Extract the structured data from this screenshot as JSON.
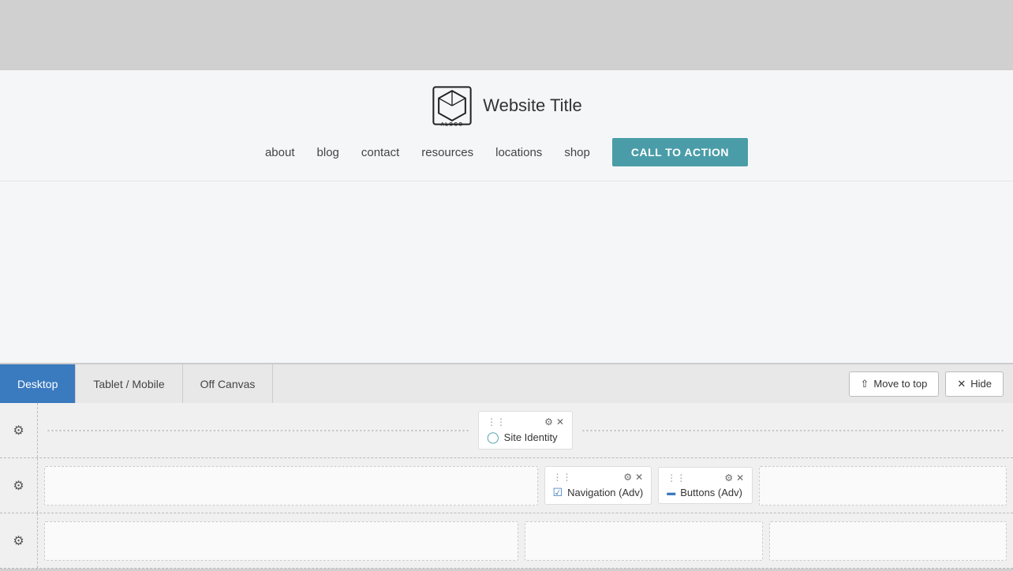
{
  "topArea": {
    "height": 88
  },
  "siteHeader": {
    "logoAlt": "ALOGO",
    "siteTitle": "Website Title",
    "navItems": [
      {
        "label": "about"
      },
      {
        "label": "blog"
      },
      {
        "label": "contact"
      },
      {
        "label": "resources"
      },
      {
        "label": "locations"
      },
      {
        "label": "shop"
      }
    ],
    "ctaLabel": "CALL TO ACTION"
  },
  "toolbar": {
    "tabs": [
      {
        "label": "Desktop",
        "active": true
      },
      {
        "label": "Tablet / Mobile",
        "active": false
      },
      {
        "label": "Off Canvas",
        "active": false
      }
    ],
    "moveToTopLabel": "Move to top",
    "hideLabel": "Hide"
  },
  "builderRows": [
    {
      "id": "row1",
      "widgets": [
        {
          "label": "Site Identity",
          "icon": "circle-icon"
        }
      ]
    },
    {
      "id": "row2",
      "widgets": [
        {
          "label": "Navigation (Adv)",
          "icon": "nav-icon"
        },
        {
          "label": "Buttons (Adv)",
          "icon": "buttons-icon"
        }
      ]
    },
    {
      "id": "row3",
      "widgets": []
    }
  ]
}
